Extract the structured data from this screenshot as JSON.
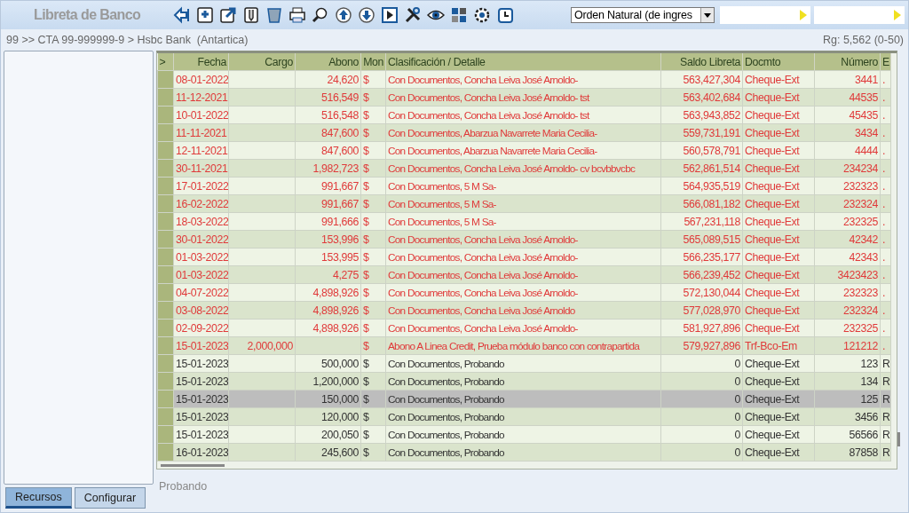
{
  "app_title": "Libreta de Banco",
  "sort_select": {
    "value": "Orden Natural (de ingres"
  },
  "breadcrumb": "99 >> CTA 99-999999-9 > Hsbc Bank  (Antartica)",
  "record_count": "Rg: 5,562 (0-50)",
  "table": {
    "columns": [
      ">",
      "Fecha",
      "Cargo",
      "Abono",
      "Mon",
      "Clasificación / Detalle",
      "Saldo Libreta",
      "Docmto",
      "Número",
      "E"
    ],
    "rows": [
      {
        "fecha": "08-01-2022",
        "cargo": "",
        "abono": "24,620",
        "mon": "$",
        "detalle": "Con Documentos, Concha Leiva José Arnoldo-",
        "saldo": "563,427,304",
        "docmto": "Cheque-Ext",
        "numero": "3441",
        "e": ".",
        "color": "#e03a3a",
        "selected": false
      },
      {
        "fecha": "11-12-2021",
        "cargo": "",
        "abono": "516,549",
        "mon": "$",
        "detalle": "Con Documentos, Concha Leiva José Arnoldo- tst",
        "saldo": "563,402,684",
        "docmto": "Cheque-Ext",
        "numero": "44535",
        "e": ".",
        "color": "#e03a3a",
        "selected": false
      },
      {
        "fecha": "10-01-2022",
        "cargo": "",
        "abono": "516,548",
        "mon": "$",
        "detalle": "Con Documentos, Concha Leiva José Arnoldo- tst",
        "saldo": "563,943,852",
        "docmto": "Cheque-Ext",
        "numero": "45435",
        "e": ".",
        "color": "#e03a3a",
        "selected": false
      },
      {
        "fecha": "11-11-2021",
        "cargo": "",
        "abono": "847,600",
        "mon": "$",
        "detalle": "Con Documentos, Abarzua Navarrete Maria Cecilia-",
        "saldo": "559,731,191",
        "docmto": "Cheque-Ext",
        "numero": "3434",
        "e": ".",
        "color": "#e03a3a",
        "selected": false
      },
      {
        "fecha": "12-11-2021",
        "cargo": "",
        "abono": "847,600",
        "mon": "$",
        "detalle": "Con Documentos, Abarzua Navarrete Maria Cecilia-",
        "saldo": "560,578,791",
        "docmto": "Cheque-Ext",
        "numero": "4444",
        "e": ".",
        "color": "#e03a3a",
        "selected": false
      },
      {
        "fecha": "30-11-2021",
        "cargo": "",
        "abono": "1,982,723",
        "mon": "$",
        "detalle": "Con Documentos, Concha Leiva José Arnoldo- cv bcvbbvcbc",
        "saldo": "562,861,514",
        "docmto": "Cheque-Ext",
        "numero": "234234",
        "e": ".",
        "color": "#e03a3a",
        "selected": false
      },
      {
        "fecha": "17-01-2022",
        "cargo": "",
        "abono": "991,667",
        "mon": "$",
        "detalle": "Con Documentos, 5 M Sa-",
        "saldo": "564,935,519",
        "docmto": "Cheque-Ext",
        "numero": "232323",
        "e": ".",
        "color": "#e03a3a",
        "selected": false
      },
      {
        "fecha": "16-02-2022",
        "cargo": "",
        "abono": "991,667",
        "mon": "$",
        "detalle": "Con Documentos, 5 M Sa-",
        "saldo": "566,081,182",
        "docmto": "Cheque-Ext",
        "numero": "232324",
        "e": ".",
        "color": "#e03a3a",
        "selected": false
      },
      {
        "fecha": "18-03-2022",
        "cargo": "",
        "abono": "991,666",
        "mon": "$",
        "detalle": "Con Documentos, 5 M Sa-",
        "saldo": "567,231,118",
        "docmto": "Cheque-Ext",
        "numero": "232325",
        "e": ".",
        "color": "#e03a3a",
        "selected": false
      },
      {
        "fecha": "30-01-2022",
        "cargo": "",
        "abono": "153,996",
        "mon": "$",
        "detalle": "Con Documentos, Concha Leiva José Arnoldo-",
        "saldo": "565,089,515",
        "docmto": "Cheque-Ext",
        "numero": "42342",
        "e": ".",
        "color": "#e03a3a",
        "selected": false
      },
      {
        "fecha": "01-03-2022",
        "cargo": "",
        "abono": "153,995",
        "mon": "$",
        "detalle": "Con Documentos, Concha Leiva José Arnoldo-",
        "saldo": "566,235,177",
        "docmto": "Cheque-Ext",
        "numero": "42343",
        "e": ".",
        "color": "#e03a3a",
        "selected": false
      },
      {
        "fecha": "01-03-2022",
        "cargo": "",
        "abono": "4,275",
        "mon": "$",
        "detalle": "Con Documentos, Concha Leiva José Arnoldo-",
        "saldo": "566,239,452",
        "docmto": "Cheque-Ext",
        "numero": "3423423",
        "e": ".",
        "color": "#e03a3a",
        "selected": false
      },
      {
        "fecha": "04-07-2022",
        "cargo": "",
        "abono": "4,898,926",
        "mon": "$",
        "detalle": "Con Documentos, Concha Leiva José Arnoldo-",
        "saldo": "572,130,044",
        "docmto": "Cheque-Ext",
        "numero": "232323",
        "e": ".",
        "color": "#e03a3a",
        "selected": false
      },
      {
        "fecha": "03-08-2022",
        "cargo": "",
        "abono": "4,898,926",
        "mon": "$",
        "detalle": "Con Documentos, Concha Leiva José Arnoldo",
        "saldo": "577,028,970",
        "docmto": "Cheque-Ext",
        "numero": "232324",
        "e": ".",
        "color": "#e03a3a",
        "selected": false
      },
      {
        "fecha": "02-09-2022",
        "cargo": "",
        "abono": "4,898,926",
        "mon": "$",
        "detalle": "Con Documentos, Concha Leiva José Arnoldo-",
        "saldo": "581,927,896",
        "docmto": "Cheque-Ext",
        "numero": "232325",
        "e": ".",
        "color": "#e03a3a",
        "selected": false
      },
      {
        "fecha": "15-01-2023",
        "cargo": "2,000,000",
        "abono": "",
        "mon": "$",
        "detalle": "Abono A Linea Credit, Prueba módulo banco con contrapartida",
        "saldo": "579,927,896",
        "docmto": "Trf-Bco-Em",
        "numero": "121212",
        "e": ".",
        "color": "#e03a3a",
        "selected": false
      },
      {
        "fecha": "15-01-2023",
        "cargo": "",
        "abono": "500,000",
        "mon": "$",
        "detalle": "Con Documentos, Probando",
        "saldo": "0",
        "docmto": "Cheque-Ext",
        "numero": "123",
        "e": "R",
        "color": "#333333",
        "selected": false
      },
      {
        "fecha": "15-01-2023",
        "cargo": "",
        "abono": "1,200,000",
        "mon": "$",
        "detalle": "Con Documentos, Probando",
        "saldo": "0",
        "docmto": "Cheque-Ext",
        "numero": "134",
        "e": "R",
        "color": "#333333",
        "selected": false
      },
      {
        "fecha": "15-01-2023",
        "cargo": "",
        "abono": "150,000",
        "mon": "$",
        "detalle": "Con Documentos, Probando",
        "saldo": "0",
        "docmto": "Cheque-Ext",
        "numero": "125",
        "e": "R",
        "color": "#333333",
        "selected": true
      },
      {
        "fecha": "15-01-2023",
        "cargo": "",
        "abono": "120,000",
        "mon": "$",
        "detalle": "Con Documentos, Probando",
        "saldo": "0",
        "docmto": "Cheque-Ext",
        "numero": "3456",
        "e": "R",
        "color": "#333333",
        "selected": false
      },
      {
        "fecha": "15-01-2023",
        "cargo": "",
        "abono": "200,050",
        "mon": "$",
        "detalle": "Con Documentos, Probando",
        "saldo": "0",
        "docmto": "Cheque-Ext",
        "numero": "56566",
        "e": "R",
        "color": "#333333",
        "selected": false
      },
      {
        "fecha": "16-01-2023",
        "cargo": "",
        "abono": "245,600",
        "mon": "$",
        "detalle": "Con Documentos, Probando",
        "saldo": "0",
        "docmto": "Cheque-Ext",
        "numero": "87858",
        "e": "R",
        "color": "#333333",
        "selected": false
      }
    ]
  },
  "tabs": [
    {
      "label": "Recursos",
      "selected": true
    },
    {
      "label": "Configurar",
      "selected": false
    }
  ],
  "detail_text": "Probando"
}
